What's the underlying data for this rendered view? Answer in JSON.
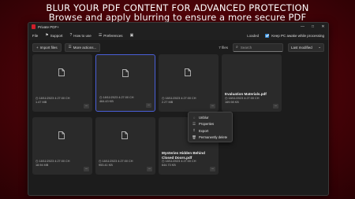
{
  "banner": {
    "line1": "BLUR YOUR PDF CONTENT FOR ADVANCED PROTECTION",
    "line2": "Browse and apply blurring to ensure a more secure PDF"
  },
  "window": {
    "title": "Private PDF+",
    "controls": [
      "—",
      "□",
      "✕"
    ]
  },
  "menu": {
    "file": "File",
    "support": "Support",
    "how_to_use": "How to use",
    "preferences": "Preferences",
    "loaded": "Loaded",
    "keep_awake": "Keep PC awake while processing"
  },
  "toolbar": {
    "import": "Import files",
    "more_actions": "More actions...",
    "files_count": "7 files",
    "search_placeholder": "Search",
    "sort": "Last modified"
  },
  "files": [
    {
      "name": "",
      "date": "18/11/2023 4:27:00 CH",
      "size": "1.47 MB"
    },
    {
      "name": "",
      "date": "18/11/2023 4:27:00 CH",
      "size": "464.43 KB"
    },
    {
      "name": "",
      "date": "18/11/2023 4:27:00 CH",
      "size": "2.27 MB"
    },
    {
      "name": "Evaluation Materials.pdf",
      "date": "18/11/2023 4:27:00 CH",
      "size": "169.98 KB"
    },
    {
      "name": "",
      "date": "18/11/2023 4:27:00 CH",
      "size": "18.94 MB"
    },
    {
      "name": "",
      "date": "18/11/2023 4:27:00 CH",
      "size": "953.41 KB"
    },
    {
      "name": "Mysteries Hidden Behind Closed Doors.pdf",
      "date": "18/11/2023 4:27:00 CH",
      "size": "644.73 KB"
    }
  ],
  "context_menu": [
    {
      "icon": "blur-icon",
      "label": "Unblur"
    },
    {
      "icon": "info-icon",
      "label": "Properties"
    },
    {
      "icon": "export-icon",
      "label": "Export"
    },
    {
      "icon": "trash-icon",
      "label": "Permanently delete"
    }
  ],
  "colors": {
    "accent": "#4a5fd8",
    "brand": "#d01e2a",
    "checkbox": "#3b8fd9"
  }
}
